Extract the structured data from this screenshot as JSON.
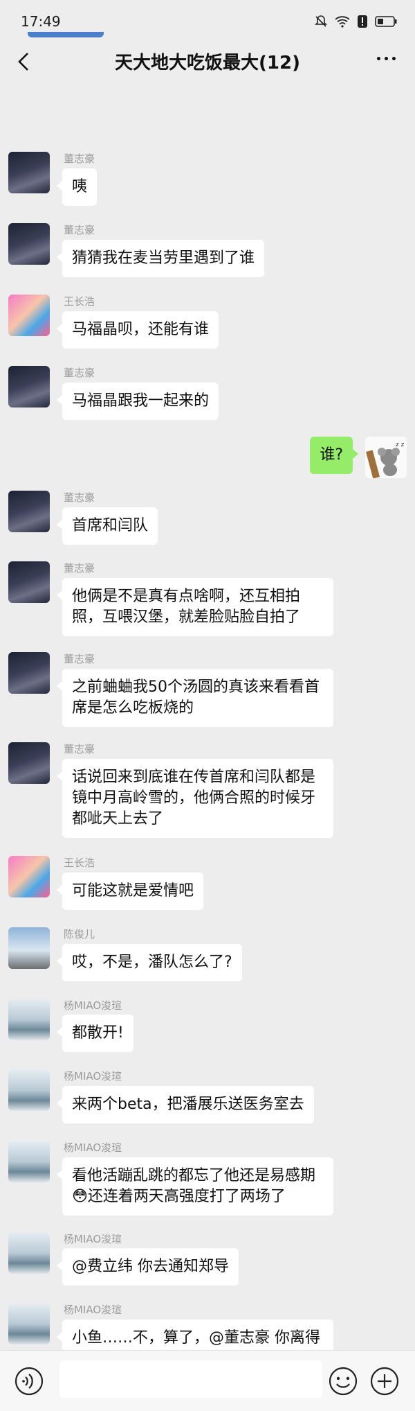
{
  "status": {
    "time": "17:49"
  },
  "header": {
    "title": "天大地大吃饭最大(12)"
  },
  "messages": [
    {
      "sender": "董志豪",
      "text": "咦"
    },
    {
      "sender": "董志豪",
      "text": "猜猜我在麦当劳里遇到了谁"
    },
    {
      "sender": "王长浩",
      "text": "马福晶呗，还能有谁"
    },
    {
      "sender": "董志豪",
      "text": "马福晶跟我一起来的"
    },
    {
      "sender": "",
      "text": "谁?"
    },
    {
      "sender": "董志豪",
      "text": "首席和闫队"
    },
    {
      "sender": "董志豪",
      "text": "他俩是不是真有点啥啊，还互相拍照，互喂汉堡，就差脸贴脸自拍了"
    },
    {
      "sender": "董志豪",
      "text": "之前蛐蛐我50个汤圆的真该来看看首席是怎么吃板烧的"
    },
    {
      "sender": "董志豪",
      "text": "话说回来到底谁在传首席和闫队都是镜中月高岭雪的，他俩合照的时候牙都呲天上去了"
    },
    {
      "sender": "王长浩",
      "text": "可能这就是爱情吧"
    },
    {
      "sender": "陈俊儿",
      "text": "哎，不是，潘队怎么了?"
    },
    {
      "sender": "杨MIAO浚瑄",
      "text": "都散开!"
    },
    {
      "sender": "杨MIAO浚瑄",
      "text": "来两个beta，把潘展乐送医务室去"
    },
    {
      "sender": "杨MIAO浚瑄",
      "text": "看他活蹦乱跳的都忘了他还是易感期😳还连着两天高强度打了两场了"
    },
    {
      "sender": "杨MIAO浚瑄",
      "text": "@费立纬 你去通知郑导"
    },
    {
      "sender": "杨MIAO浚瑄",
      "text": "小鱼……不，算了，@董志豪 你离得近，通知下顺哥"
    }
  ]
}
